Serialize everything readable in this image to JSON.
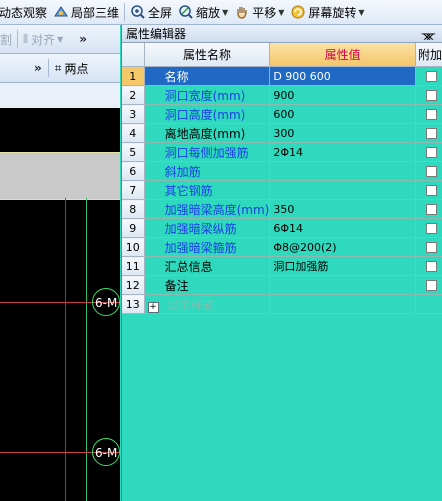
{
  "toolbar": {
    "items": [
      {
        "label": "动态观察",
        "icon": "orbit-icon",
        "has_dropdown": false
      },
      {
        "label": "局部三维",
        "icon": "local-3d-icon",
        "has_dropdown": false
      },
      {
        "label": "全屏",
        "icon": "fullscreen-icon",
        "has_dropdown": false
      },
      {
        "label": "缩放",
        "icon": "zoom-icon",
        "has_dropdown": true
      },
      {
        "label": "平移",
        "icon": "pan-icon",
        "has_dropdown": true
      },
      {
        "label": "屏幕旋转",
        "icon": "screen-rotate-icon",
        "has_dropdown": true
      }
    ]
  },
  "left_toolbar": {
    "split_label": "分割",
    "align_label": "对齐",
    "overflow_label": "»",
    "two_point_label": "两点"
  },
  "canvas": {
    "axis_labels": [
      "6-M",
      "6-M"
    ]
  },
  "property_panel": {
    "title": "属性编辑器",
    "pin_icon": "pin-icon",
    "columns": {
      "name": "属性名称",
      "value": "属性值",
      "extra": "附加"
    },
    "rows": [
      {
        "num": "1",
        "name": "名称",
        "value": "D 900 600",
        "color": "blue",
        "selected": true
      },
      {
        "num": "2",
        "name": "洞口宽度(mm)",
        "value": "900",
        "color": "blue",
        "selected": false
      },
      {
        "num": "3",
        "name": "洞口高度(mm)",
        "value": "600",
        "color": "blue",
        "selected": false
      },
      {
        "num": "4",
        "name": "离地高度(mm)",
        "value": "300",
        "color": "black",
        "selected": false
      },
      {
        "num": "5",
        "name": "洞口每侧加强筋",
        "value": "2Φ14",
        "color": "blue",
        "selected": false
      },
      {
        "num": "6",
        "name": "斜加筋",
        "value": "",
        "color": "blue",
        "selected": false
      },
      {
        "num": "7",
        "name": "其它钢筋",
        "value": "",
        "color": "blue",
        "selected": false
      },
      {
        "num": "8",
        "name": "加强暗梁高度(mm)",
        "value": "350",
        "color": "blue",
        "selected": false
      },
      {
        "num": "9",
        "name": "加强暗梁纵筋",
        "value": "6Φ14",
        "color": "blue",
        "selected": false
      },
      {
        "num": "10",
        "name": "加强暗梁箍筋",
        "value": "Φ8@200(2)",
        "color": "blue",
        "selected": false
      },
      {
        "num": "11",
        "name": "汇总信息",
        "value": "洞口加强筋",
        "color": "black",
        "selected": false
      },
      {
        "num": "12",
        "name": "备注",
        "value": "",
        "color": "black",
        "selected": false
      },
      {
        "num": "13",
        "name": "显示样式",
        "value": "",
        "color": "gray",
        "selected": false,
        "expandable": true
      }
    ]
  }
}
